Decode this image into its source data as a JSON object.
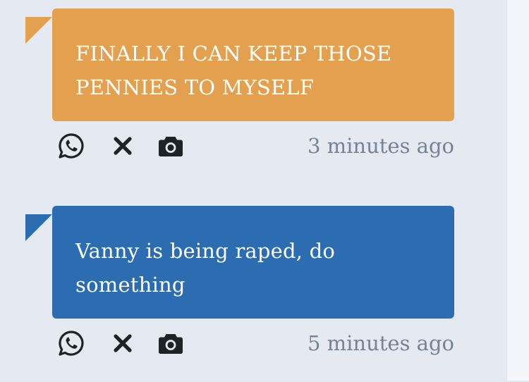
{
  "posts": [
    {
      "text": "FINALLY I CAN KEEP THOSE PENNIES TO MYSELF",
      "time": "3 minutes ago",
      "color": "#e3a04f"
    },
    {
      "text": "Vanny is being raped, do something",
      "time": "5 minutes ago",
      "color": "#2c6cb1"
    }
  ],
  "icons": [
    "whatsapp-icon",
    "x-icon",
    "camera-icon"
  ],
  "colors": {
    "background": "#e5e9f2",
    "icon": "#1f2328",
    "timestamp": "#778292"
  }
}
